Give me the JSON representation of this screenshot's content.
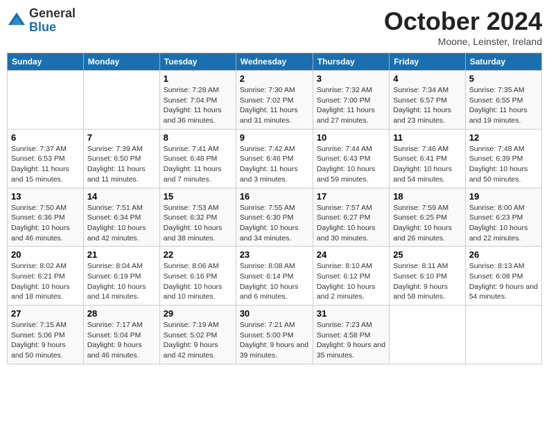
{
  "header": {
    "logo_general": "General",
    "logo_blue": "Blue",
    "title": "October 2024",
    "location": "Moone, Leinster, Ireland"
  },
  "days_of_week": [
    "Sunday",
    "Monday",
    "Tuesday",
    "Wednesday",
    "Thursday",
    "Friday",
    "Saturday"
  ],
  "weeks": [
    [
      {
        "day": "",
        "sunrise": "",
        "sunset": "",
        "daylight": ""
      },
      {
        "day": "",
        "sunrise": "",
        "sunset": "",
        "daylight": ""
      },
      {
        "day": "1",
        "sunrise": "Sunrise: 7:28 AM",
        "sunset": "Sunset: 7:04 PM",
        "daylight": "Daylight: 11 hours and 36 minutes."
      },
      {
        "day": "2",
        "sunrise": "Sunrise: 7:30 AM",
        "sunset": "Sunset: 7:02 PM",
        "daylight": "Daylight: 11 hours and 31 minutes."
      },
      {
        "day": "3",
        "sunrise": "Sunrise: 7:32 AM",
        "sunset": "Sunset: 7:00 PM",
        "daylight": "Daylight: 11 hours and 27 minutes."
      },
      {
        "day": "4",
        "sunrise": "Sunrise: 7:34 AM",
        "sunset": "Sunset: 6:57 PM",
        "daylight": "Daylight: 11 hours and 23 minutes."
      },
      {
        "day": "5",
        "sunrise": "Sunrise: 7:35 AM",
        "sunset": "Sunset: 6:55 PM",
        "daylight": "Daylight: 11 hours and 19 minutes."
      }
    ],
    [
      {
        "day": "6",
        "sunrise": "Sunrise: 7:37 AM",
        "sunset": "Sunset: 6:53 PM",
        "daylight": "Daylight: 11 hours and 15 minutes."
      },
      {
        "day": "7",
        "sunrise": "Sunrise: 7:39 AM",
        "sunset": "Sunset: 6:50 PM",
        "daylight": "Daylight: 11 hours and 11 minutes."
      },
      {
        "day": "8",
        "sunrise": "Sunrise: 7:41 AM",
        "sunset": "Sunset: 6:48 PM",
        "daylight": "Daylight: 11 hours and 7 minutes."
      },
      {
        "day": "9",
        "sunrise": "Sunrise: 7:42 AM",
        "sunset": "Sunset: 6:46 PM",
        "daylight": "Daylight: 11 hours and 3 minutes."
      },
      {
        "day": "10",
        "sunrise": "Sunrise: 7:44 AM",
        "sunset": "Sunset: 6:43 PM",
        "daylight": "Daylight: 10 hours and 59 minutes."
      },
      {
        "day": "11",
        "sunrise": "Sunrise: 7:46 AM",
        "sunset": "Sunset: 6:41 PM",
        "daylight": "Daylight: 10 hours and 54 minutes."
      },
      {
        "day": "12",
        "sunrise": "Sunrise: 7:48 AM",
        "sunset": "Sunset: 6:39 PM",
        "daylight": "Daylight: 10 hours and 50 minutes."
      }
    ],
    [
      {
        "day": "13",
        "sunrise": "Sunrise: 7:50 AM",
        "sunset": "Sunset: 6:36 PM",
        "daylight": "Daylight: 10 hours and 46 minutes."
      },
      {
        "day": "14",
        "sunrise": "Sunrise: 7:51 AM",
        "sunset": "Sunset: 6:34 PM",
        "daylight": "Daylight: 10 hours and 42 minutes."
      },
      {
        "day": "15",
        "sunrise": "Sunrise: 7:53 AM",
        "sunset": "Sunset: 6:32 PM",
        "daylight": "Daylight: 10 hours and 38 minutes."
      },
      {
        "day": "16",
        "sunrise": "Sunrise: 7:55 AM",
        "sunset": "Sunset: 6:30 PM",
        "daylight": "Daylight: 10 hours and 34 minutes."
      },
      {
        "day": "17",
        "sunrise": "Sunrise: 7:57 AM",
        "sunset": "Sunset: 6:27 PM",
        "daylight": "Daylight: 10 hours and 30 minutes."
      },
      {
        "day": "18",
        "sunrise": "Sunrise: 7:59 AM",
        "sunset": "Sunset: 6:25 PM",
        "daylight": "Daylight: 10 hours and 26 minutes."
      },
      {
        "day": "19",
        "sunrise": "Sunrise: 8:00 AM",
        "sunset": "Sunset: 6:23 PM",
        "daylight": "Daylight: 10 hours and 22 minutes."
      }
    ],
    [
      {
        "day": "20",
        "sunrise": "Sunrise: 8:02 AM",
        "sunset": "Sunset: 6:21 PM",
        "daylight": "Daylight: 10 hours and 18 minutes."
      },
      {
        "day": "21",
        "sunrise": "Sunrise: 8:04 AM",
        "sunset": "Sunset: 6:19 PM",
        "daylight": "Daylight: 10 hours and 14 minutes."
      },
      {
        "day": "22",
        "sunrise": "Sunrise: 8:06 AM",
        "sunset": "Sunset: 6:16 PM",
        "daylight": "Daylight: 10 hours and 10 minutes."
      },
      {
        "day": "23",
        "sunrise": "Sunrise: 8:08 AM",
        "sunset": "Sunset: 6:14 PM",
        "daylight": "Daylight: 10 hours and 6 minutes."
      },
      {
        "day": "24",
        "sunrise": "Sunrise: 8:10 AM",
        "sunset": "Sunset: 6:12 PM",
        "daylight": "Daylight: 10 hours and 2 minutes."
      },
      {
        "day": "25",
        "sunrise": "Sunrise: 8:11 AM",
        "sunset": "Sunset: 6:10 PM",
        "daylight": "Daylight: 9 hours and 58 minutes."
      },
      {
        "day": "26",
        "sunrise": "Sunrise: 8:13 AM",
        "sunset": "Sunset: 6:08 PM",
        "daylight": "Daylight: 9 hours and 54 minutes."
      }
    ],
    [
      {
        "day": "27",
        "sunrise": "Sunrise: 7:15 AM",
        "sunset": "Sunset: 5:06 PM",
        "daylight": "Daylight: 9 hours and 50 minutes."
      },
      {
        "day": "28",
        "sunrise": "Sunrise: 7:17 AM",
        "sunset": "Sunset: 5:04 PM",
        "daylight": "Daylight: 9 hours and 46 minutes."
      },
      {
        "day": "29",
        "sunrise": "Sunrise: 7:19 AM",
        "sunset": "Sunset: 5:02 PM",
        "daylight": "Daylight: 9 hours and 42 minutes."
      },
      {
        "day": "30",
        "sunrise": "Sunrise: 7:21 AM",
        "sunset": "Sunset: 5:00 PM",
        "daylight": "Daylight: 9 hours and 39 minutes."
      },
      {
        "day": "31",
        "sunrise": "Sunrise: 7:23 AM",
        "sunset": "Sunset: 4:58 PM",
        "daylight": "Daylight: 9 hours and 35 minutes."
      },
      {
        "day": "",
        "sunrise": "",
        "sunset": "",
        "daylight": ""
      },
      {
        "day": "",
        "sunrise": "",
        "sunset": "",
        "daylight": ""
      }
    ]
  ]
}
